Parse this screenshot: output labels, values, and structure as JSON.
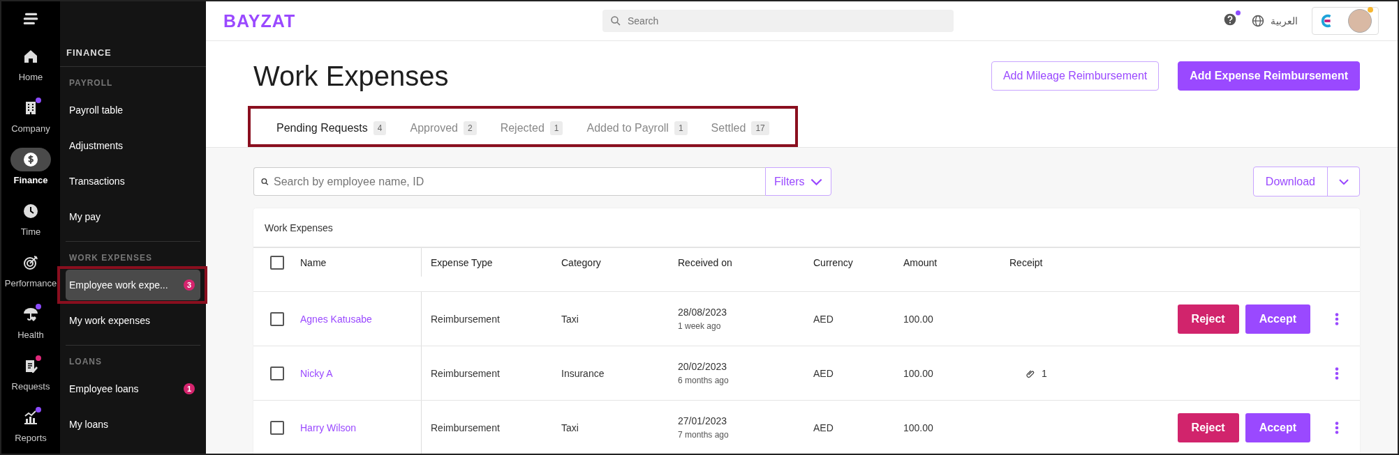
{
  "rail": [
    {
      "kind": "menu"
    },
    {
      "kind": "home",
      "label": "Home",
      "selected": false
    },
    {
      "kind": "building",
      "label": "Company",
      "selected": false,
      "color": "#8c4bff"
    },
    {
      "kind": "dollar",
      "label": "Finance",
      "selected": true
    },
    {
      "kind": "clock",
      "label": "Time",
      "selected": false
    },
    {
      "kind": "target",
      "label": "Performance",
      "selected": false
    },
    {
      "kind": "umbrella",
      "label": "Health",
      "selected": false,
      "color": "#8c4bff"
    },
    {
      "kind": "clipboard",
      "label": "Requests",
      "selected": false,
      "color": "#e0287a"
    },
    {
      "kind": "chart",
      "label": "Reports",
      "selected": false,
      "color": "#8c4bff"
    }
  ],
  "subnav": {
    "title": "FINANCE",
    "sections": [
      {
        "heading": "PAYROLL",
        "items": [
          {
            "label": "Payroll table",
            "selected": false
          },
          {
            "label": "Adjustments",
            "selected": false
          },
          {
            "label": "Transactions",
            "selected": false
          },
          {
            "label": "My pay",
            "selected": false
          }
        ]
      },
      {
        "heading": "WORK EXPENSES",
        "items": [
          {
            "label": "Employee work expe...",
            "selected": true,
            "badge": "3",
            "annotated": true
          },
          {
            "label": "My work expenses",
            "selected": false
          }
        ]
      },
      {
        "heading": "LOANS",
        "items": [
          {
            "label": "Employee loans",
            "selected": false,
            "badge": "1"
          },
          {
            "label": "My loans",
            "selected": false
          }
        ]
      }
    ]
  },
  "header": {
    "logo": "BAYZAT",
    "search": {
      "placeholder": "Search"
    },
    "language": "العربية"
  },
  "page": {
    "title": "Work Expenses",
    "buttons": [
      {
        "label": "Add Mileage Reimbursement",
        "kind": "outline"
      },
      {
        "label": "Add Expense Reimbursement",
        "kind": "primary"
      }
    ],
    "tabs_annotated": true,
    "tabs": [
      {
        "label": "Pending Requests",
        "count": "4",
        "selected": true
      },
      {
        "label": "Approved",
        "count": "2",
        "selected": false
      },
      {
        "label": "Rejected",
        "count": "1",
        "selected": false
      },
      {
        "label": "Added to Payroll",
        "count": "1",
        "selected": false
      },
      {
        "label": "Settled",
        "count": "17",
        "selected": false
      }
    ],
    "search": {
      "placeholder": "Search by employee name, ID"
    },
    "filters": "Filters",
    "download": "Download"
  },
  "table": {
    "caption": "Work Expenses",
    "all_checked": false,
    "columns": [
      "Name",
      "Expense Type",
      "Category",
      "Received on",
      "Currency",
      "Amount",
      "Receipt"
    ],
    "rows": [
      {
        "checked": false,
        "name": "Agnes Katusabe",
        "expense_type": "Reimbursement",
        "category": "Taxi",
        "received_on": "28/08/2023",
        "received_ago": "1 week ago",
        "currency": "AED",
        "amount": "100.00",
        "actions": [
          {
            "label": "Reject",
            "kind": "reject"
          },
          {
            "label": "Accept",
            "kind": "accept"
          }
        ]
      },
      {
        "checked": false,
        "name": "Nicky A",
        "expense_type": "Reimbursement",
        "category": "Insurance",
        "received_on": "20/02/2023",
        "received_ago": "6 months ago",
        "currency": "AED",
        "amount": "100.00",
        "receipt": "1"
      },
      {
        "checked": false,
        "name": "Harry Wilson",
        "expense_type": "Reimbursement",
        "category": "Taxi",
        "received_on": "27/01/2023",
        "received_ago": "7 months ago",
        "currency": "AED",
        "amount": "100.00",
        "actions": [
          {
            "label": "Reject",
            "kind": "reject"
          },
          {
            "label": "Accept",
            "kind": "accept"
          }
        ]
      }
    ]
  }
}
